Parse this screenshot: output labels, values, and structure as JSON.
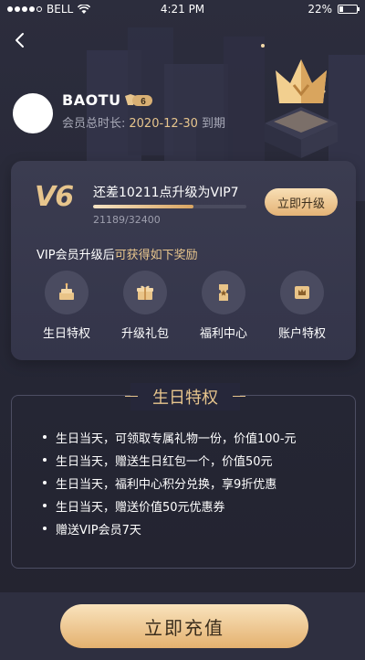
{
  "status_bar": {
    "carrier": "BELL",
    "time": "4:21 PM",
    "battery": "22%"
  },
  "profile": {
    "username": "BAOTU",
    "vip_badge": "6",
    "member_label": "会员总时长:",
    "expire_date": "2020-12-30",
    "expire_suffix": "到期"
  },
  "card": {
    "level_logo": "V6",
    "upgrade_text": "还差10211点升级为VIP7",
    "progress_text": "21189/32400",
    "progress_fraction": 0.654,
    "upgrade_button": "立即升级",
    "rewards_prefix": "VIP会员升级后",
    "rewards_highlight": "可获得如下奖励",
    "perks": [
      {
        "label": "生日特权",
        "icon": "birthday-cake-icon"
      },
      {
        "label": "升级礼包",
        "icon": "gift-box-icon"
      },
      {
        "label": "福利中心",
        "icon": "coupon-ticket-icon"
      },
      {
        "label": "账户特权",
        "icon": "crown-card-icon"
      }
    ]
  },
  "benefits_panel": {
    "title": "生日特权",
    "items": [
      "生日当天，可领取专属礼物一份，价值100-元",
      "生日当天，赠送生日红包一个，价值50元",
      "生日当天，福利中心积分兑换，享9折优惠",
      "生日当天，赠送价值50元优惠券",
      "赠送VIP会员7天"
    ]
  },
  "bottom": {
    "recharge_button": "立即充值"
  },
  "colors": {
    "gold": "#e7c58d",
    "background": "#2c2d3d",
    "card": "#3b3c50"
  }
}
